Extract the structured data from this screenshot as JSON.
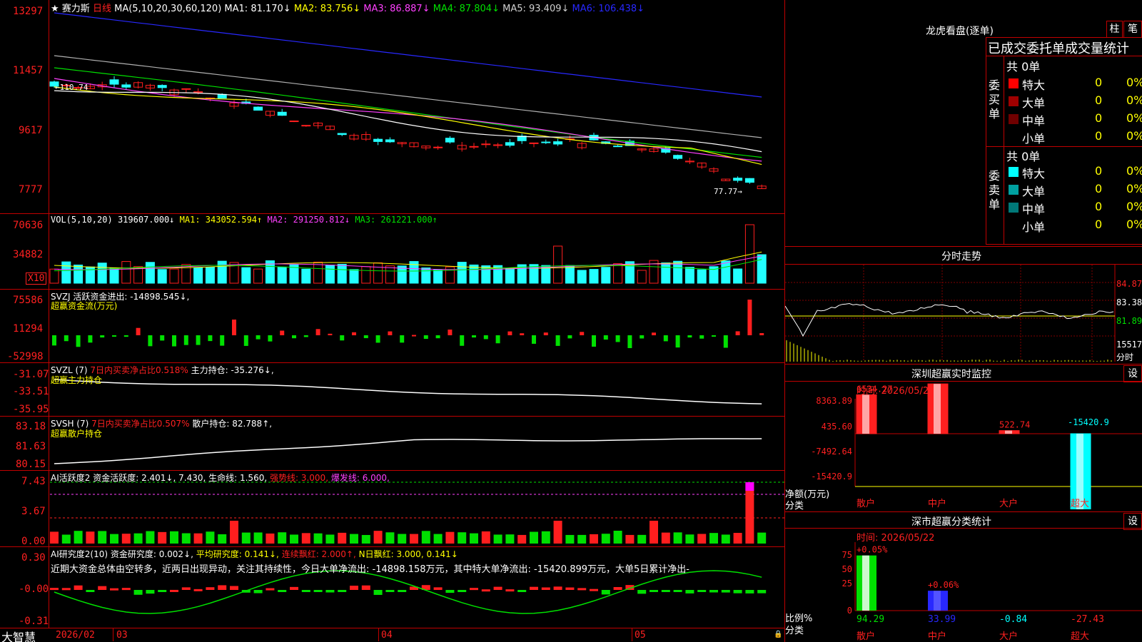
{
  "colors": {
    "up": "#ff1e1e",
    "down": "#22ffff",
    "border": "#c00000",
    "green": "#00e000",
    "white": "#ffffff",
    "yellow": "#ffff00",
    "magenta": "#ff40ff",
    "blue": "#2828ff",
    "gray": "#b0b0b0"
  },
  "main": {
    "header": {
      "star": "★",
      "stock": "赛力斯",
      "period": "日线",
      "ma_params": "MA(5,10,20,30,60,120)",
      "ma1": "MA1: 81.170↓",
      "ma2": "MA2: 83.756↓",
      "ma3": "MA3: 86.887↓",
      "ma4": "MA4: 87.804↓",
      "ma5": "MA5: 93.409↓",
      "ma6": "MA6: 106.438↓"
    },
    "y_ticks": [
      "13297",
      "11457",
      "9617",
      "7777"
    ],
    "high_label": "110.74",
    "low_label": "77.77"
  },
  "vol": {
    "header": "VOL(5,10,20)",
    "value": "319607.000↓",
    "ma1": "MA1: 343052.594↑",
    "ma2": "MA2: 291250.812↓",
    "ma3": "MA3: 261221.000↑",
    "y_ticks": [
      "70636",
      "34882"
    ],
    "unit": "X10"
  },
  "svzj": {
    "header": "SVZJ",
    "title": "活跃资金进出: -14898.545↓,",
    "subtitle": "超赢资金流(万元)",
    "y_ticks": [
      "75586",
      "11294",
      "-52998"
    ]
  },
  "svzl": {
    "header": "SVZL (7)",
    "text1": "7日内买卖净占比0.518%",
    "text2": "主力持仓: -35.276↓,",
    "subtitle": "超赢主力持仓",
    "y_ticks": [
      "-31.07",
      "-33.51",
      "-35.95"
    ]
  },
  "svsh": {
    "header": "SVSH (7)",
    "text1": "7日内买卖净占比0.507%",
    "text2": "散户持仓: 82.788↑,",
    "subtitle": "超赢散户持仓",
    "y_ticks": [
      "83.18",
      "81.63",
      "80.15"
    ]
  },
  "ai1": {
    "header": "AI活跃度2",
    "t1": "资金活跃度: 2.401↓, 7.430,",
    "t2": "生命线: 1.560,",
    "t3": "强势线: 3.000,",
    "t4": "爆发线: 6.000,",
    "y_ticks": [
      "7.43",
      "3.67",
      "0.00"
    ]
  },
  "ai2": {
    "header": "AI研究度2(10)",
    "t1": "资金研究度: 0.002↓,",
    "t2": "平均研究度: 0.141↓,",
    "t3": "连续飘红: 2.000↑,",
    "t4": "N日飘红: 3.000, 0.141↓",
    "comment": "近期大资金总体由空转多，近两日出现异动，关注其持续性，今日大单净流出: -14898.158万元，其中特大单净流出: -15420.899万元，大单5日累计净出-",
    "y_ticks": [
      "0.30",
      "-0.00",
      "-0.31"
    ]
  },
  "time_axis": {
    "logo": "大智慧",
    "labels": [
      "2026/02",
      "03",
      "04",
      "05"
    ]
  },
  "dragon": {
    "title": "龙虎看盘(逐单)",
    "btn1": "柱",
    "btn2": "笔",
    "head": "已成交委托单成交量统计",
    "buy_label": "委买单",
    "sell_label": "委卖单",
    "buy_total": "共 0单",
    "sell_total": "共 0单",
    "buy_rows": [
      {
        "name": "特大",
        "count": "0",
        "pct": "0%",
        "color": "#ff0000"
      },
      {
        "name": "大单",
        "count": "0",
        "pct": "0%",
        "color": "#a00000"
      },
      {
        "name": "中单",
        "count": "0",
        "pct": "0%",
        "color": "#700000"
      },
      {
        "name": "小单",
        "count": "0",
        "pct": "0%",
        "color": ""
      }
    ],
    "sell_rows": [
      {
        "name": "特大",
        "count": "0",
        "pct": "0%",
        "color": "#00ffff"
      },
      {
        "name": "大单",
        "count": "0",
        "pct": "0%",
        "color": "#00a0a0"
      },
      {
        "name": "中单",
        "count": "0",
        "pct": "0%",
        "color": "#007878"
      },
      {
        "name": "小单",
        "count": "0",
        "pct": "0%",
        "color": ""
      }
    ]
  },
  "fenshi": {
    "title": "分时走势",
    "y_labels": [
      "84.87",
      "83.38",
      "81.89"
    ],
    "vol_label": "15517",
    "bottom_label": "分时"
  },
  "monitor": {
    "title": "深圳超赢实时监控",
    "btn": "设",
    "time": "时间: 2026/05/22",
    "y_labels": [
      "8363.89",
      "435.60",
      "-7492.64",
      "-15420.9"
    ],
    "unit": "净额(万元)",
    "cat_label": "分类",
    "bars": [
      {
        "label": "6534.27",
        "value": 6534.27,
        "cat": "散户",
        "color": "#ff2020"
      },
      {
        "label": "8363.89",
        "value": 8363.89,
        "cat": "中户",
        "color": "#ff2020"
      },
      {
        "label": "522.74",
        "value": 522.74,
        "cat": "大户",
        "color": "#ff2020"
      },
      {
        "label": "-15420.9",
        "value": -15420.9,
        "cat": "超大",
        "color": "#00ffff"
      }
    ]
  },
  "classify": {
    "title": "深市超赢分类统计",
    "btn": "设",
    "time": "时间: 2026/05/22",
    "y_labels": [
      "75",
      "50",
      "25",
      "0"
    ],
    "ratio_label": "比例%",
    "cat_label": "分类",
    "bars": [
      {
        "top": "+0.05%",
        "value": 94.29,
        "label": "94.29",
        "cat": "散户",
        "color": "#00e000"
      },
      {
        "top": "+0.06%",
        "value": 33.99,
        "label": "33.99",
        "cat": "中户",
        "color": "#2828ff"
      },
      {
        "top": "",
        "value": 0,
        "label": "-0.84",
        "cat": "大户",
        "color": "#00ffff"
      },
      {
        "top": "",
        "value": 0,
        "label": "-27.43",
        "cat": "超大",
        "color": "#ff2020"
      }
    ]
  }
}
